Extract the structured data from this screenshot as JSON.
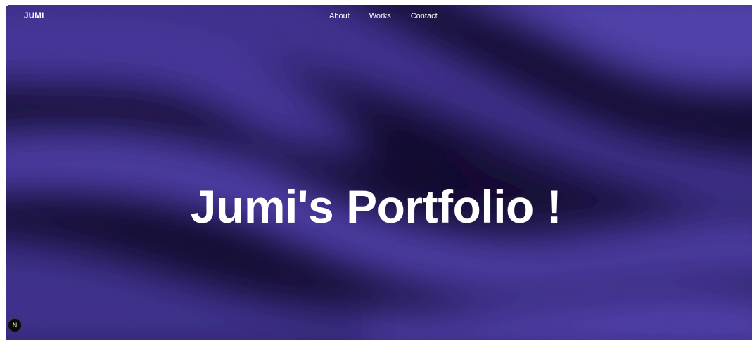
{
  "nav": {
    "logo": "JUMI",
    "links": [
      "About",
      "Works",
      "Contact"
    ]
  },
  "hero": {
    "title": "Jumi's Portfolio !"
  },
  "dev_badge": {
    "icon": "next-logo-icon",
    "letter": "N"
  },
  "colors": {
    "purple": "#4e3ea6",
    "dark": "#120b2e",
    "text": "#ffffff"
  }
}
